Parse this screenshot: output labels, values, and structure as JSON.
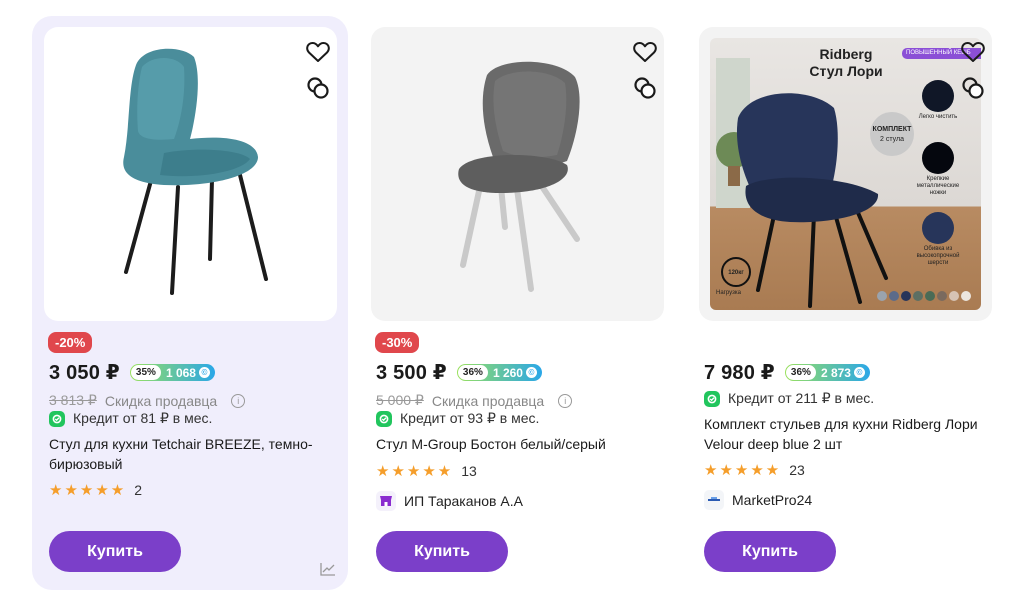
{
  "products": [
    {
      "discount": "-20%",
      "price": "3 050 ₽",
      "cashback_pct": "35%",
      "cashback_value": "1 068",
      "old_price": "3 813 ₽",
      "seller_discount_label": "Скидка продавца",
      "credit": "Кредит от 81 ₽ в мес.",
      "title": "Стул для кухни Tetchair BREEZE, темно-бирюзовый",
      "rating_count": "2",
      "buy_label": "Купить"
    },
    {
      "discount": "-30%",
      "price": "3 500 ₽",
      "cashback_pct": "36%",
      "cashback_value": "1 260",
      "old_price": "5 000 ₽",
      "seller_discount_label": "Скидка продавца",
      "credit": "Кредит от 93 ₽ в мес.",
      "title": "Стул M-Group Бостон белый/серый",
      "rating_count": "13",
      "seller": "ИП Тараканов А.А",
      "buy_label": "Купить"
    },
    {
      "price": "7 980 ₽",
      "cashback_pct": "36%",
      "cashback_value": "2 873",
      "credit": "Кредит от 211 ₽ в мес.",
      "title": "Комплект стульев для кухни Ridberg Лори Velour deep blue 2 шт",
      "rating_count": "23",
      "seller": "MarketPro24",
      "buy_label": "Купить",
      "image_text": {
        "brand": "Ridberg",
        "name": "Стул Лори",
        "ribbon": "ПОВЫШЕННЫЙ КЕШБ",
        "kit_line1": "КОМПЛЕКТ",
        "kit_line2": "2 стула",
        "feature1": "Легко чистить",
        "feature2": "Крепкие металлические ножки",
        "feature3": "Обивка из высокопрочной шерсти",
        "load_value": "120кг",
        "load_label": "Нагрузка"
      }
    }
  ],
  "colors": {
    "accent": "#7b3fc9",
    "discount_badge": "#e0474c",
    "stars": "#f59e2b",
    "highlight_card": "#f0eefc"
  },
  "icons": [
    "heart-icon",
    "compare-icon",
    "info-icon",
    "credit-icon",
    "star-icon",
    "seller-icon",
    "trend-icon"
  ]
}
